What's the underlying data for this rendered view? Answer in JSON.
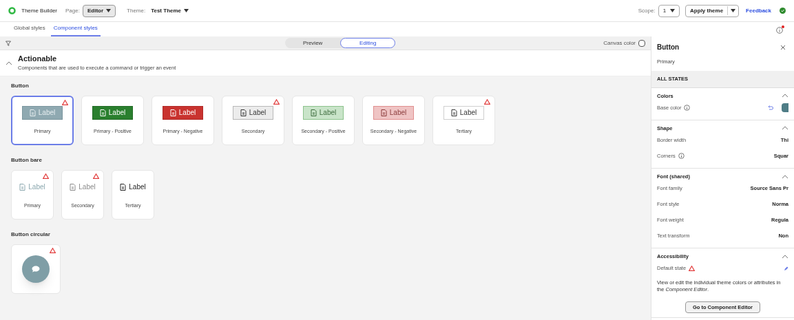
{
  "header": {
    "app_name": "Theme Builder",
    "page_label": "Page:",
    "page_value": "Editor",
    "theme_label": "Theme:",
    "theme_value": "Test Theme",
    "scope_label": "Scope:",
    "scope_value": "1",
    "apply_button": "Apply theme",
    "feedback_link": "Feedback"
  },
  "tabs": [
    {
      "label": "Global styles",
      "selected": false
    },
    {
      "label": "Component styles",
      "selected": true
    }
  ],
  "toolbar": {
    "modes": [
      {
        "label": "Preview",
        "selected": false
      },
      {
        "label": "Editing",
        "selected": true
      }
    ],
    "canvas_color_label": "Canvas color",
    "canvas_color_checked": false
  },
  "section": {
    "title": "Actionable",
    "subtitle": "Components that are used to execute a command or trigger an event",
    "expanded": true
  },
  "groups": [
    {
      "title": "Button",
      "items": [
        {
          "kind": "primary",
          "button_label": "Label",
          "caption": "Primary",
          "warning": true,
          "selected": true
        },
        {
          "kind": "primary-positive",
          "button_label": "Label",
          "caption": "Primary - Positive",
          "warning": false,
          "selected": false
        },
        {
          "kind": "primary-negative",
          "button_label": "Label",
          "caption": "Primary - Negative",
          "warning": false,
          "selected": false
        },
        {
          "kind": "secondary",
          "button_label": "Label",
          "caption": "Secondary",
          "warning": true,
          "selected": false
        },
        {
          "kind": "secondary-positive",
          "button_label": "Label",
          "caption": "Secondary - Positive",
          "warning": false,
          "selected": false
        },
        {
          "kind": "secondary-negative",
          "button_label": "Label",
          "caption": "Secondary - Negative",
          "warning": false,
          "selected": false
        },
        {
          "kind": "tertiary",
          "button_label": "Label",
          "caption": "Tertiary",
          "warning": true,
          "selected": false
        }
      ]
    },
    {
      "title": "Button bare",
      "items": [
        {
          "kind": "bare-primary",
          "button_label": "Label",
          "caption": "Primary",
          "warning": true,
          "selected": false
        },
        {
          "kind": "bare-secondary",
          "button_label": "Label",
          "caption": "Secondary",
          "warning": true,
          "selected": false
        },
        {
          "kind": "bare-tertiary",
          "button_label": "Label",
          "caption": "Tertiary",
          "warning": false,
          "selected": false
        }
      ]
    },
    {
      "title": "Button circular",
      "items": [
        {
          "kind": "circular",
          "warning": true,
          "selected": false
        }
      ]
    }
  ],
  "panel": {
    "title": "Button",
    "subtitle": "Primary",
    "states_heading": "ALL STATES",
    "sections": [
      {
        "title": "Colors",
        "expanded": true,
        "rows": [
          {
            "kind": "color",
            "label": "Base color",
            "info": true,
            "color": "#4f7d86"
          }
        ]
      },
      {
        "title": "Shape",
        "expanded": true,
        "rows": [
          {
            "kind": "value",
            "label": "Border width",
            "info": false,
            "value": "Thi"
          },
          {
            "kind": "value",
            "label": "Corners",
            "info": true,
            "value": "Squar"
          }
        ]
      },
      {
        "title": "Font (shared)",
        "expanded": true,
        "rows": [
          {
            "kind": "value",
            "label": "Font family",
            "info": false,
            "value": "Source Sans Pr"
          },
          {
            "kind": "value",
            "label": "Font style",
            "info": false,
            "value": "Norma"
          },
          {
            "kind": "value",
            "label": "Font weight",
            "info": false,
            "value": "Regula"
          },
          {
            "kind": "value",
            "label": "Text transform",
            "info": false,
            "value": "Non"
          }
        ]
      },
      {
        "title": "Accessibility",
        "expanded": true,
        "rows": [
          {
            "kind": "edit",
            "label": "Default state",
            "warning": true
          }
        ],
        "description": "View or edit the individual theme colors or attributes in the *Component Editor*.",
        "button": "Go to Component Editor"
      }
    ]
  }
}
